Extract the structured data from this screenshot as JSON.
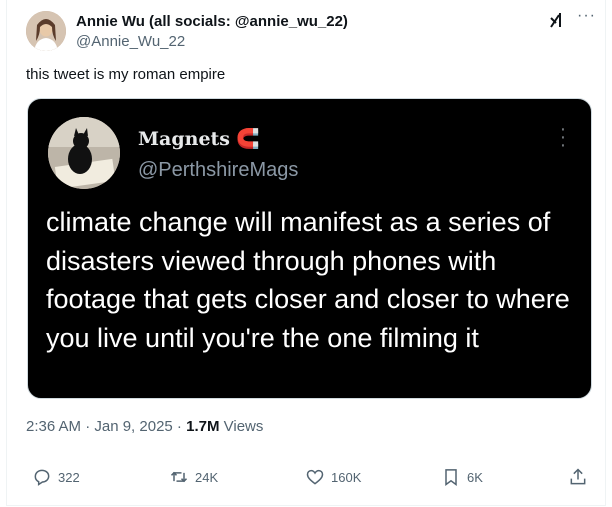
{
  "tweet": {
    "author": {
      "display_name": "Annie Wu (all socials: @annie_wu_22)",
      "handle": "@Annie_Wu_22"
    },
    "text": "this tweet is my roman empire",
    "quoted_media": {
      "name": "Magnets",
      "handle": "@PerthshireMags",
      "text": "climate change will manifest as a series of disasters viewed through phones with footage that gets closer and closer to where you live until you're the one filming it"
    },
    "meta": {
      "time_date": "2:36 AM · Jan 9, 2025",
      "separator": " · ",
      "views_count": "1.7M",
      "views_label": " Views"
    },
    "actions": {
      "replies": "322",
      "reposts": "24K",
      "likes": "160K",
      "bookmarks": "6K"
    }
  },
  "icons": [
    "grok-icon",
    "more-icon",
    "reply-icon",
    "repost-icon",
    "like-icon",
    "bookmark-icon",
    "share-icon",
    "magnet-icon"
  ],
  "colors": {
    "text_primary": "#0f1419",
    "text_secondary": "#536471",
    "media_background": "#000000"
  }
}
